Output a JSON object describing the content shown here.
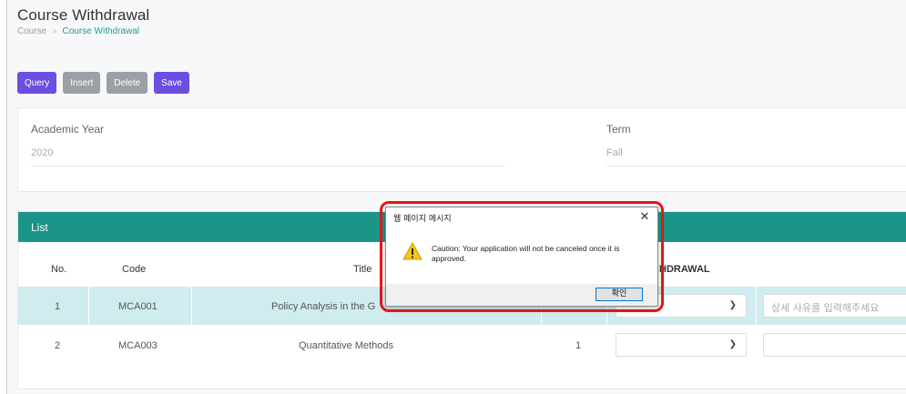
{
  "page": {
    "title": "Course Withdrawal",
    "breadcrumb": {
      "root": "Course",
      "separator": ">",
      "current": "Course Withdrawal"
    }
  },
  "toolbar": {
    "query": "Query",
    "insert": "Insert",
    "delete": "Delete",
    "save": "Save"
  },
  "filters": {
    "academic_year_label": "Academic Year",
    "academic_year_value": "2020",
    "term_label": "Term",
    "term_value": "Fall"
  },
  "list": {
    "header": "List",
    "columns": [
      "No.",
      "Code",
      "Title",
      "WITHDRAWAL",
      "HDRAWAL"
    ],
    "rows": [
      {
        "no": "1",
        "code": "MCA001",
        "title": "Policy Analysis in the G",
        "credit": "",
        "reason_placeholder": "상세 사유를 입력해주세요"
      },
      {
        "no": "2",
        "code": "MCA003",
        "title": "Quantitative Methods",
        "credit": "1",
        "reason_placeholder": ""
      }
    ]
  },
  "dialog": {
    "title": "웹 페이지 메시지",
    "message": "Caution: Your application will not be canceled once it is approved.",
    "ok": "확인",
    "close_glyph": "✕"
  },
  "colors": {
    "accent_purple": "#6a4fe0",
    "accent_teal": "#1a9588",
    "highlight_row": "#cfecef",
    "annotation_red": "#e01818"
  }
}
